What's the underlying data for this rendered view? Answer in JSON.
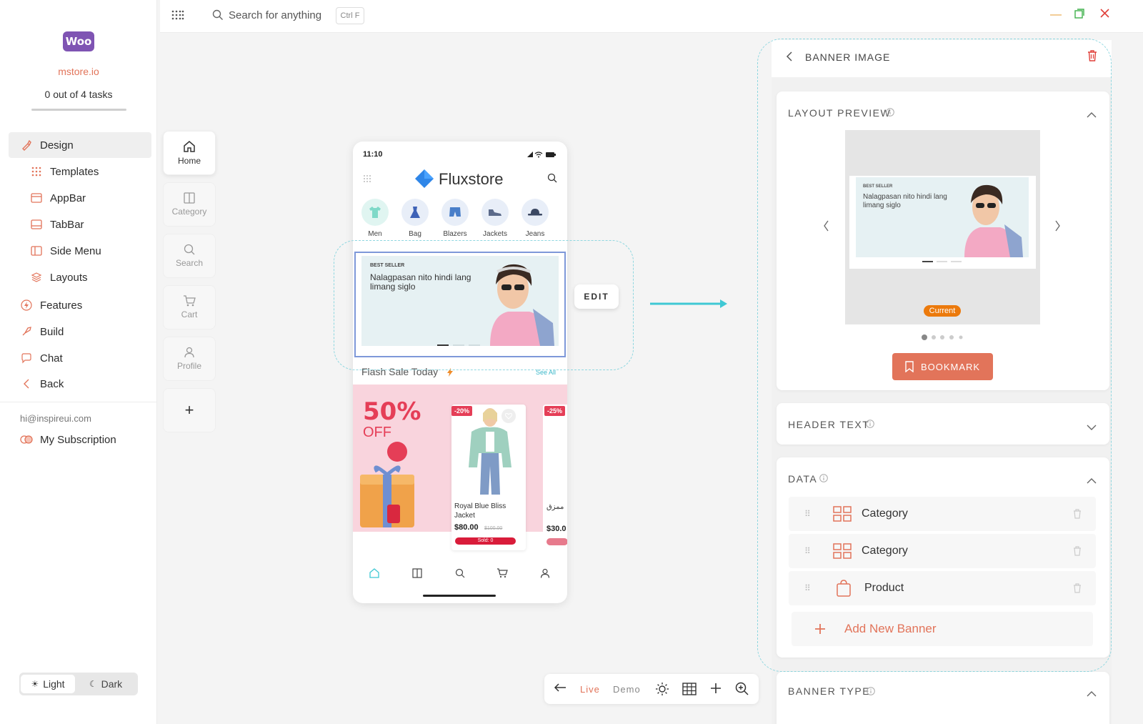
{
  "sidebar": {
    "logo": "Woo",
    "store": "mstore.io",
    "tasks": "0 out of 4 tasks",
    "progress": 0,
    "items": [
      {
        "label": "Design",
        "icon": "brush-icon"
      },
      {
        "label": "Templates",
        "icon": "grid-icon"
      },
      {
        "label": "AppBar",
        "icon": "appbar-icon"
      },
      {
        "label": "TabBar",
        "icon": "tabbar-icon"
      },
      {
        "label": "Side Menu",
        "icon": "side-menu-icon"
      },
      {
        "label": "Layouts",
        "icon": "layers-icon"
      },
      {
        "label": "Features",
        "icon": "bolt-icon"
      },
      {
        "label": "Build",
        "icon": "rocket-icon"
      },
      {
        "label": "Chat",
        "icon": "chat-icon"
      },
      {
        "label": "Back",
        "icon": "chevron-left-icon"
      }
    ],
    "email": "hi@inspireui.com",
    "subscription": "My Subscription",
    "theme_light": "Light",
    "theme_dark": "Dark"
  },
  "topbar": {
    "search_placeholder": "Search for anything",
    "shortcut": "Ctrl F"
  },
  "tabs": [
    {
      "label": "Home"
    },
    {
      "label": "Category"
    },
    {
      "label": "Search"
    },
    {
      "label": "Cart"
    },
    {
      "label": "Profile"
    }
  ],
  "phone": {
    "time": "11:10",
    "brand": "Fluxstore",
    "categories": [
      "Men",
      "Bag",
      "Blazers",
      "Jackets",
      "Jeans"
    ],
    "banner": {
      "tag": "BEST SELLER",
      "text": "Nalagpasan nito hindi lang limang siglo"
    },
    "flash_title": "Flash Sale Today",
    "see_all": "See All",
    "promo_big": "50%",
    "promo_small": "OFF",
    "product": {
      "discount": "-20%",
      "name": "Royal Blue Bliss Jacket",
      "price": "$80.00",
      "old_price": "$100.00",
      "sold": "Sold: 0"
    },
    "product2": {
      "discount": "-25%",
      "name": "ممزق",
      "price": "$30.0"
    }
  },
  "edit_label": "EDIT",
  "toolbar": {
    "live": "Live",
    "demo": "Demo"
  },
  "panel": {
    "title": "BANNER IMAGE",
    "layout_preview": "LAYOUT PREVIEW",
    "preview_tag": "BEST SELLER",
    "preview_text": "Nalagpasan nito hindi lang limang siglo",
    "current": "Current",
    "bookmark": "BOOKMARK",
    "header_text": "HEADER TEXT",
    "data_title": "DATA",
    "data_rows": [
      {
        "label": "Category",
        "icon": "category-grid-icon"
      },
      {
        "label": "Category",
        "icon": "category-grid-icon"
      },
      {
        "label": "Product",
        "icon": "shopping-bag-icon"
      }
    ],
    "add_new": "Add New Banner",
    "banner_type": "BANNER TYPE"
  },
  "colors": {
    "accent": "#e2745a",
    "cyan": "#3fc8d4",
    "brand_purple": "#7f54b3",
    "current_orange": "#ec7a0c"
  }
}
